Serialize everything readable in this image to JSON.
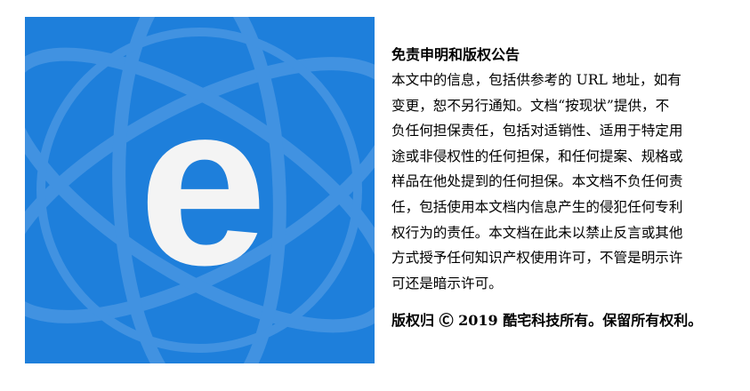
{
  "logo": {
    "letter": "e",
    "background": "#1e7fdb",
    "orbit_color": "#5aa2e8",
    "letter_color": "#f4f4f4"
  },
  "notice": {
    "title": "免责申明和版权公告",
    "lines": [
      "本文中的信息，包括供参考的 URL 地址，如有",
      "变更，恕不另行通知。文档“按现状”提供，不",
      "负任何担保责任，包括对适销性、适用于特定用",
      "途或非侵权性的任何担保，和任何提案、规格或",
      "样品在他处提到的任何担保。本文档不负任何责",
      "任，包括使用本文档内信息产生的侵犯任何专利",
      "权行为的责任。本文档在此未以禁止反言或其他",
      "方式授予任何知识产权使用许可，不管是明示许",
      "可还是暗示许可。"
    ],
    "copyright": "版权归 Ⓒ 2019 酷宅科技所有。保留所有权利。"
  }
}
